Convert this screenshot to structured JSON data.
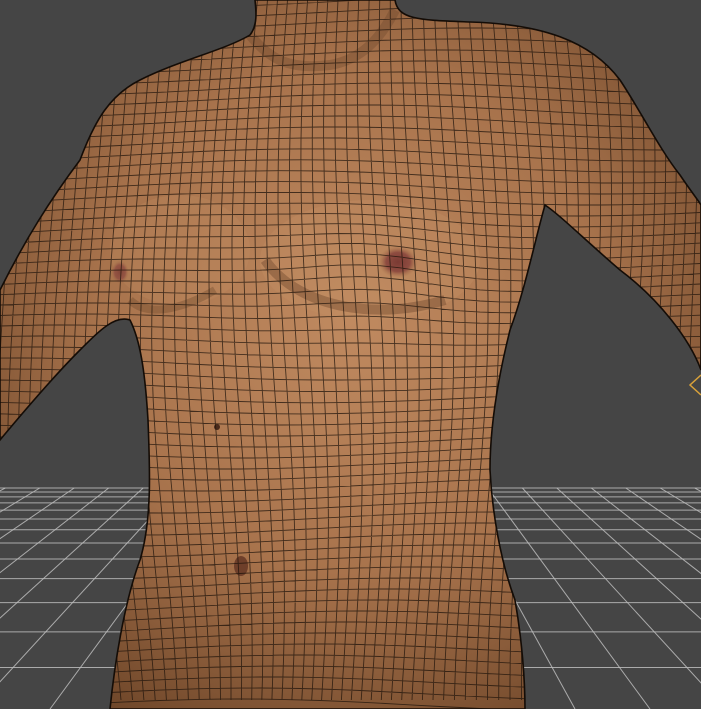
{
  "viewport": {
    "background_color": "#454545",
    "ground_grid_color": "#bdbdbd",
    "skin_base_color": "#b07a54",
    "skin_shadow_color": "#6b452a",
    "wireframe_color": "#1e130b",
    "nipple_color": "#8a4a40",
    "selection_bracket_color": "#d8a13a"
  },
  "icons": [
    "wireframe-torso",
    "ground-grid",
    "selection-corner-icon"
  ]
}
